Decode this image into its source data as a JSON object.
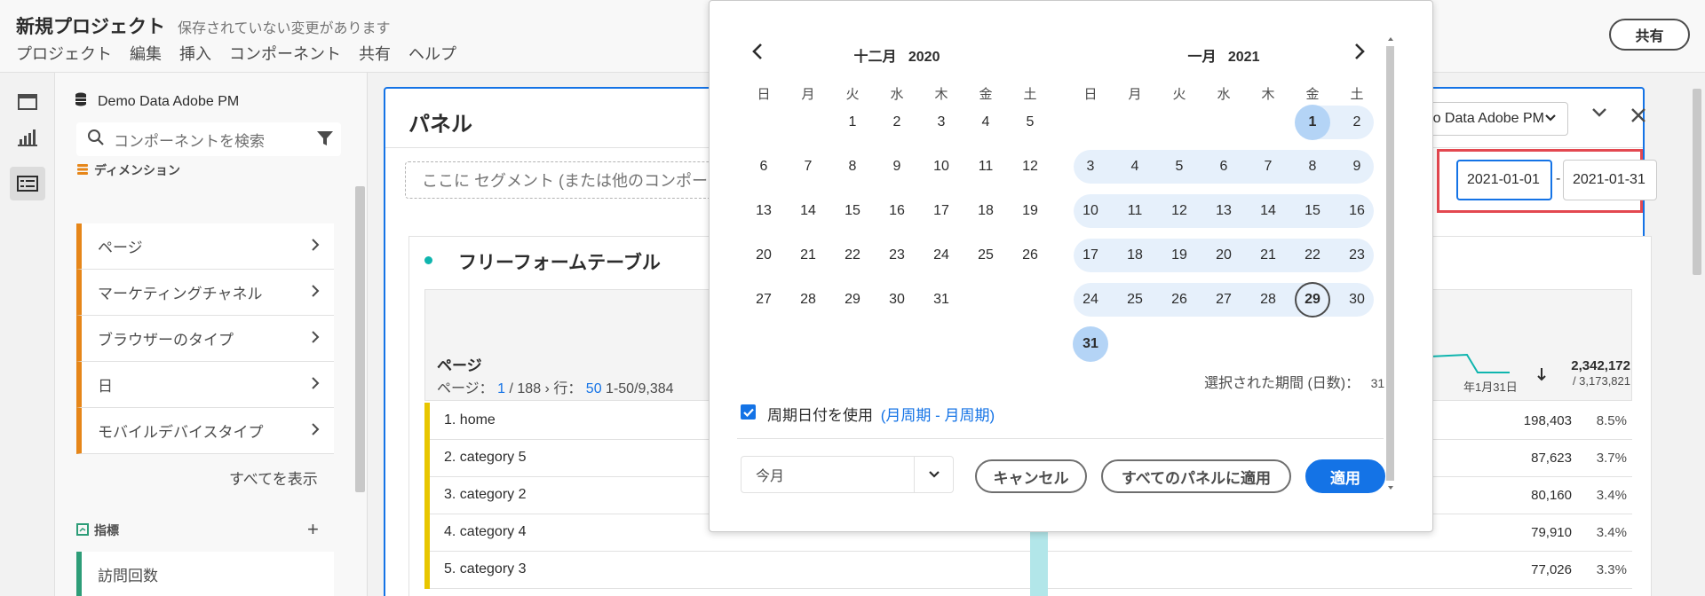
{
  "header": {
    "project_title": "新規プロジェクト",
    "unsaved_note": "保存されていない変更があります",
    "menu": [
      "プロジェクト",
      "編集",
      "挿入",
      "コンポーネント",
      "共有",
      "ヘルプ"
    ],
    "share_label": "共有"
  },
  "rail": {
    "icons": [
      "panel-icon",
      "visualization-icon",
      "components-icon"
    ]
  },
  "components": {
    "datasource": "Demo Data Adobe PM",
    "search_placeholder": "コンポーネントを検索",
    "dimensions_heading": "ディメンション",
    "dimensions": [
      "ページ",
      "マーケティングチャネル",
      "ブラウザーのタイプ",
      "日",
      "モバイルデバイスタイプ"
    ],
    "show_all": "すべてを表示",
    "metrics_heading": "指標",
    "metrics": [
      "訪問回数"
    ]
  },
  "panel": {
    "title": "パネル",
    "segment_placeholder": "ここに セグメント (または他のコンポーネ",
    "datasource_selected": "Demo Data Adobe PM",
    "date_start": "2021-01-01",
    "date_end": "2021-01-31",
    "date_separator": "-"
  },
  "freeform": {
    "title": "フリーフォームテーブル",
    "dimension_label": "ページ",
    "pager": {
      "page_label": "ページ：",
      "page_current": "1",
      "page_total": "/ 188",
      "rows_label": "行：",
      "rows_value": "50",
      "range": "1-50/9,384"
    },
    "axis_label": "年1月31日",
    "column_total": "2,342,172",
    "column_grand_total": "/ 3,173,821",
    "rows": [
      {
        "name": "1. home",
        "value": "198,403",
        "pct": "8.5%"
      },
      {
        "name": "2. category 5",
        "value": "87,623",
        "pct": "3.7%"
      },
      {
        "name": "3. category 2",
        "value": "80,160",
        "pct": "3.4%"
      },
      {
        "name": "4. category 4",
        "value": "79,910",
        "pct": "3.4%"
      },
      {
        "name": "5. category 3",
        "value": "77,026",
        "pct": "3.3%"
      }
    ]
  },
  "datepicker": {
    "left_month": {
      "title": "十二月",
      "year": "2020"
    },
    "right_month": {
      "title": "一月",
      "year": "2021"
    },
    "weekdays": [
      "日",
      "月",
      "火",
      "水",
      "木",
      "金",
      "土"
    ],
    "selected_days_label": "選択された期間 (日数)：",
    "selected_days": "31",
    "rolling_label": "周期日付を使用",
    "rolling_link": "(月周期 - 月周期)",
    "rolling_checked": true,
    "preset_value": "今月",
    "cancel_label": "キャンセル",
    "apply_all_label": "すべてのパネルに適用",
    "apply_label": "適用",
    "accent_color": "#1473e6",
    "range_color": "#e6f0fb"
  }
}
